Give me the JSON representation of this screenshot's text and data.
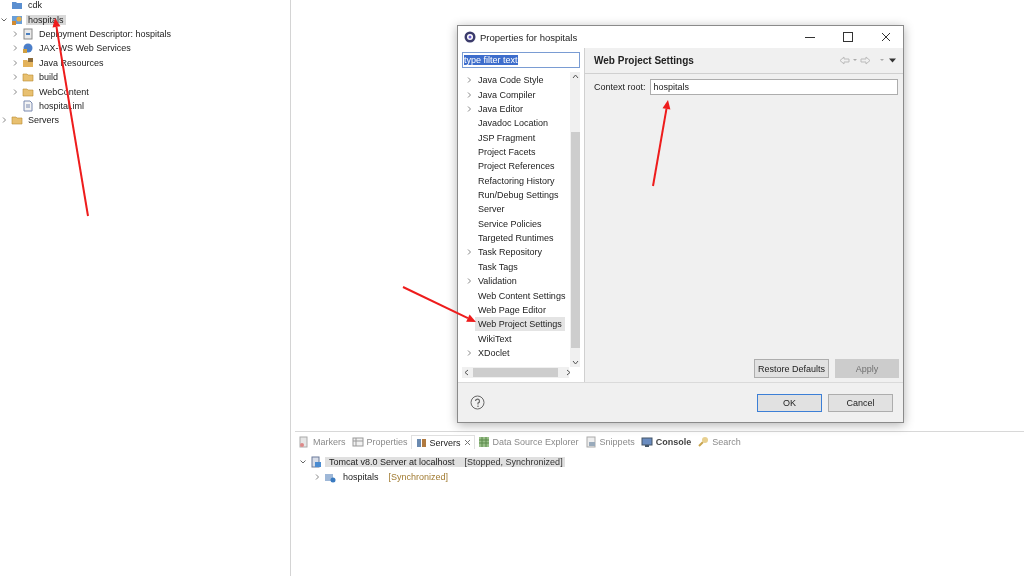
{
  "project_tree": [
    {
      "label": "cdk",
      "kind": "project"
    },
    {
      "label": "hospitals",
      "kind": "webproject",
      "expanded": true,
      "selected": true,
      "children": [
        {
          "label": "Deployment Descriptor: hospitals",
          "kind": "descriptor",
          "expanded": false,
          "selected": false
        },
        {
          "label": "JAX-WS Web Services",
          "kind": "webservice",
          "expanded": false,
          "selected": false
        },
        {
          "label": "Java Resources",
          "kind": "javares",
          "expanded": false,
          "selected": false
        },
        {
          "label": "build",
          "kind": "folder",
          "expanded": false,
          "selected": false
        },
        {
          "label": "WebContent",
          "kind": "folder",
          "expanded": false,
          "selected": false
        },
        {
          "label": "hospital.iml",
          "kind": "file",
          "selected": false
        }
      ]
    },
    {
      "label": "Servers",
      "kind": "folder",
      "expanded": false,
      "selected": false
    }
  ],
  "dialog": {
    "title": "Properties for hospitals",
    "filter": {
      "value": "type filter text",
      "text_selected": true
    },
    "pages": [
      {
        "label": "Java Code Style",
        "expandable": true,
        "selected": false
      },
      {
        "label": "Java Compiler",
        "expandable": true,
        "selected": false
      },
      {
        "label": "Java Editor",
        "expandable": true,
        "selected": false
      },
      {
        "label": "Javadoc Location",
        "expandable": false,
        "selected": false
      },
      {
        "label": "JSP Fragment",
        "expandable": false,
        "selected": false
      },
      {
        "label": "Project Facets",
        "expandable": false,
        "selected": false
      },
      {
        "label": "Project References",
        "expandable": false,
        "selected": false
      },
      {
        "label": "Refactoring History",
        "expandable": false,
        "selected": false
      },
      {
        "label": "Run/Debug Settings",
        "expandable": false,
        "selected": false
      },
      {
        "label": "Server",
        "expandable": false,
        "selected": false
      },
      {
        "label": "Service Policies",
        "expandable": false,
        "selected": false
      },
      {
        "label": "Targeted Runtimes",
        "expandable": false,
        "selected": false
      },
      {
        "label": "Task Repository",
        "expandable": true,
        "selected": false
      },
      {
        "label": "Task Tags",
        "expandable": false,
        "selected": false
      },
      {
        "label": "Validation",
        "expandable": true,
        "selected": false
      },
      {
        "label": "Web Content Settings",
        "expandable": false,
        "selected": false
      },
      {
        "label": "Web Page Editor",
        "expandable": false,
        "selected": false
      },
      {
        "label": "Web Project Settings",
        "expandable": false,
        "selected": true
      },
      {
        "label": "WikiText",
        "expandable": false,
        "selected": false
      },
      {
        "label": "XDoclet",
        "expandable": true,
        "selected": false
      }
    ],
    "page_title": "Web Project Settings",
    "context_root": {
      "label": "Context root:",
      "value": "hospitals"
    },
    "page_buttons": [
      {
        "label": "Restore Defaults",
        "disabled": false
      },
      {
        "label": "Apply",
        "disabled": true
      }
    ],
    "buttons": [
      {
        "label": "OK",
        "default": true
      },
      {
        "label": "Cancel",
        "default": false
      }
    ]
  },
  "views": {
    "tabs": [
      {
        "label": "Markers",
        "kind": "markers",
        "selected": false,
        "bold": false
      },
      {
        "label": "Properties",
        "kind": "properties",
        "selected": false,
        "bold": false
      },
      {
        "label": "Servers",
        "kind": "servers",
        "selected": true,
        "bold": false
      },
      {
        "label": "Data Source Explorer",
        "kind": "datasource",
        "selected": false,
        "bold": false
      },
      {
        "label": "Snippets",
        "kind": "snippets",
        "selected": false,
        "bold": false
      },
      {
        "label": "Console",
        "kind": "console",
        "selected": false,
        "bold": true
      },
      {
        "label": "Search",
        "kind": "search",
        "selected": false,
        "bold": false
      }
    ],
    "servers": [
      {
        "name": "Tomcat v8.0 Server at localhost",
        "status": "[Stopped, Synchronized]",
        "expanded": true,
        "selected": true,
        "children": [
          {
            "name": "hospitals",
            "status": "[Synchronized]",
            "expanded": false,
            "selected": false
          }
        ]
      }
    ]
  }
}
